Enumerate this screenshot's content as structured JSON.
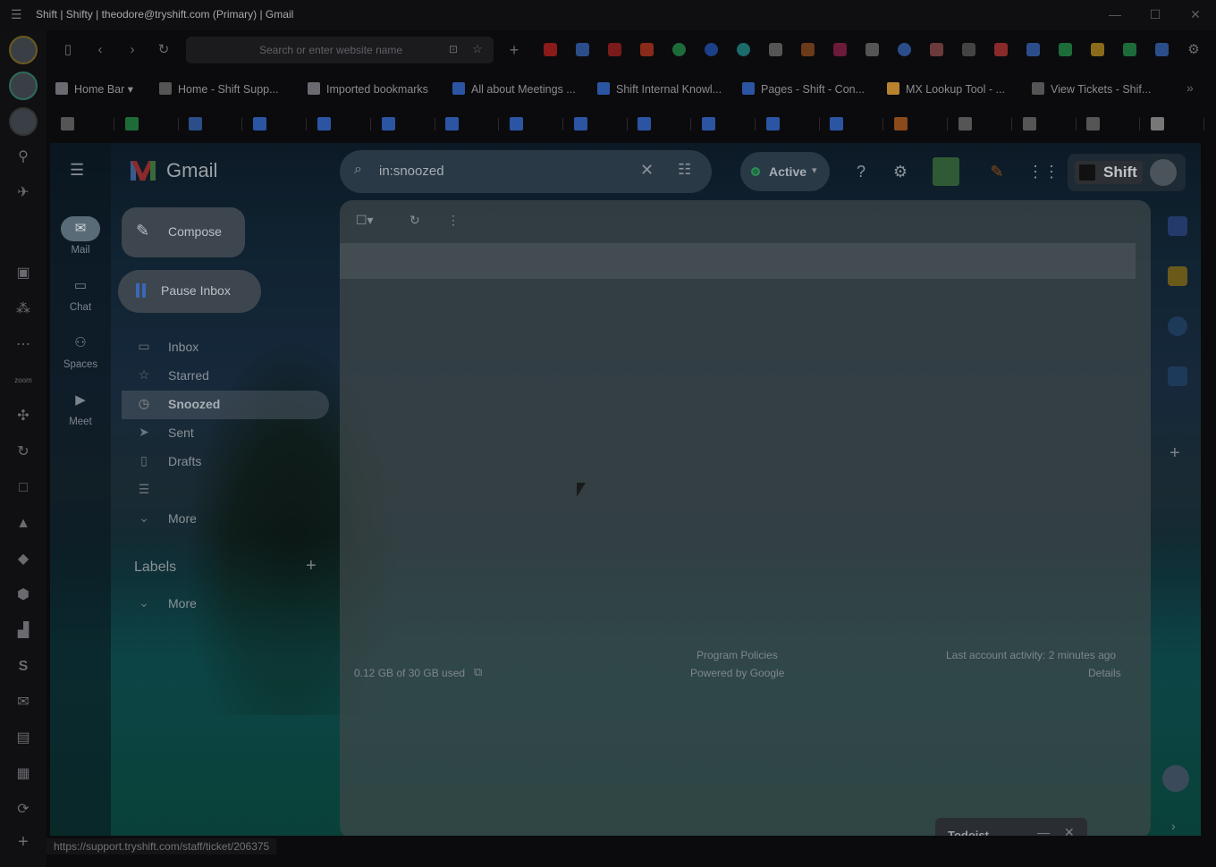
{
  "window": {
    "title": "Shift | Shifty | theodore@tryshift.com (Primary) | Gmail"
  },
  "browser": {
    "url_placeholder": "Search or enter website name",
    "bookmarks": [
      {
        "label": "Home Bar",
        "icon": "home-icon",
        "color": "#6a6a70"
      },
      {
        "label": "Home - Shift Supp...",
        "icon": "shift-icon",
        "color": "#555"
      },
      {
        "label": "Imported bookmarks",
        "icon": "folder-icon",
        "color": "#6a6a70"
      },
      {
        "label": "All about Meetings ...",
        "icon": "confluence-icon",
        "color": "#2b55a3"
      },
      {
        "label": "Shift Internal Knowl...",
        "icon": "diamond-icon",
        "color": "#2b55a3"
      },
      {
        "label": "Pages - Shift - Con...",
        "icon": "confluence-icon",
        "color": "#2b55a3"
      },
      {
        "label": "MX Lookup Tool - ...",
        "icon": "mx-icon",
        "color": "#b8822e"
      },
      {
        "label": "View Tickets - Shif...",
        "icon": "shift-icon",
        "color": "#555"
      }
    ]
  },
  "gmail": {
    "app_name": "Gmail",
    "search_query": "in:snoozed",
    "status_label": "Active",
    "compose_label": "Compose",
    "pause_label": "Pause Inbox",
    "shift_label": "Shift",
    "mini_nav": [
      {
        "label": "Mail",
        "icon": "mail-icon"
      },
      {
        "label": "Chat",
        "icon": "chat-icon"
      },
      {
        "label": "Spaces",
        "icon": "spaces-icon"
      },
      {
        "label": "Meet",
        "icon": "meet-icon"
      }
    ],
    "folders": [
      {
        "label": "Inbox",
        "icon": "inbox-icon",
        "selected": false
      },
      {
        "label": "Starred",
        "icon": "star-icon",
        "selected": false
      },
      {
        "label": "Snoozed",
        "icon": "clock-icon",
        "selected": true
      },
      {
        "label": "Sent",
        "icon": "send-icon",
        "selected": false
      },
      {
        "label": "Drafts",
        "icon": "draft-icon",
        "selected": false
      },
      {
        "label": "",
        "icon": "list-icon",
        "selected": false
      },
      {
        "label": "More",
        "icon": "chevron-down-icon",
        "selected": false
      }
    ],
    "labels_heading": "Labels",
    "labels_more": "More",
    "footer": {
      "storage": "0.12 GB of 30 GB used",
      "program_policies": "Program Policies",
      "powered_by": "Powered by Google",
      "last_activity": "Last account activity: 2 minutes ago",
      "details": "Details"
    },
    "todoist_label": "Todoist"
  },
  "status_url": "https://support.tryshift.com/staff/ticket/206375"
}
